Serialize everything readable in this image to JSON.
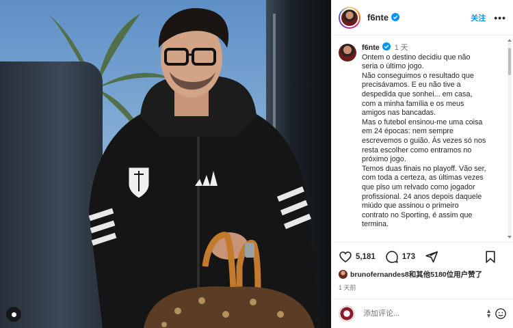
{
  "post": {
    "username": "f6nte",
    "follow_label": "关注",
    "more_label": "•••"
  },
  "caption": {
    "username": "f6nte",
    "time": "1 天",
    "lines": [
      "Ontem o destino decidiu que não",
      "seria o último jogo.",
      "Não conseguimos o resultado que",
      "precisávamos. E eu não tive a",
      "despedida que sonhei... em casa,",
      "com a minha família e os meus",
      "amigos nas bancadas.",
      "Mas o futebol ensinou-me uma coisa",
      "em 24 épocas: nem sempre",
      "escrevemos o guião. Às vezes só nos",
      "resta escolher como entramos no",
      "próximo jogo.",
      "Temos duas finais no playoff. Vão ser,",
      "com toda a certeza, as últimas vezes",
      "que piso um relvado como jogador",
      "profissional. 24 anos depois daquele",
      "miúdo que assinou o primeiro",
      "contrato no Sporting, é assim que",
      "termina."
    ]
  },
  "actions": {
    "likes_count": "5,181",
    "comments_count": "173"
  },
  "likes": {
    "user": "brunofernandes8",
    "rest": "和其他5180位用户赞了"
  },
  "posted_time": "1 天前",
  "comment": {
    "placeholder": "添加评论..."
  },
  "icons": [
    "verified-badge-icon",
    "heart-icon",
    "comment-icon",
    "share-icon",
    "bookmark-icon",
    "emoji-icon",
    "photo-tag-icon"
  ],
  "colors": {
    "accent": "#0095f6",
    "text": "#262626",
    "muted": "#737373"
  }
}
